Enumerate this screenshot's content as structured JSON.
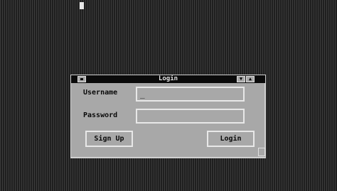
{
  "window": {
    "title": "Login",
    "controls": {
      "menu_icon": "system-menu-icon",
      "minimize_glyph": "▼",
      "maximize_glyph": "▲"
    }
  },
  "form": {
    "username_label": "Username",
    "username_value": "_",
    "password_label": "Password",
    "password_value": ""
  },
  "buttons": {
    "signup_label": "Sign Up",
    "login_label": "Login"
  },
  "colors": {
    "desktop": "#2c2c2c",
    "window_bg": "#a8a8a8",
    "titlebar": "#0a0a0a",
    "highlight": "#e8e8e8"
  }
}
